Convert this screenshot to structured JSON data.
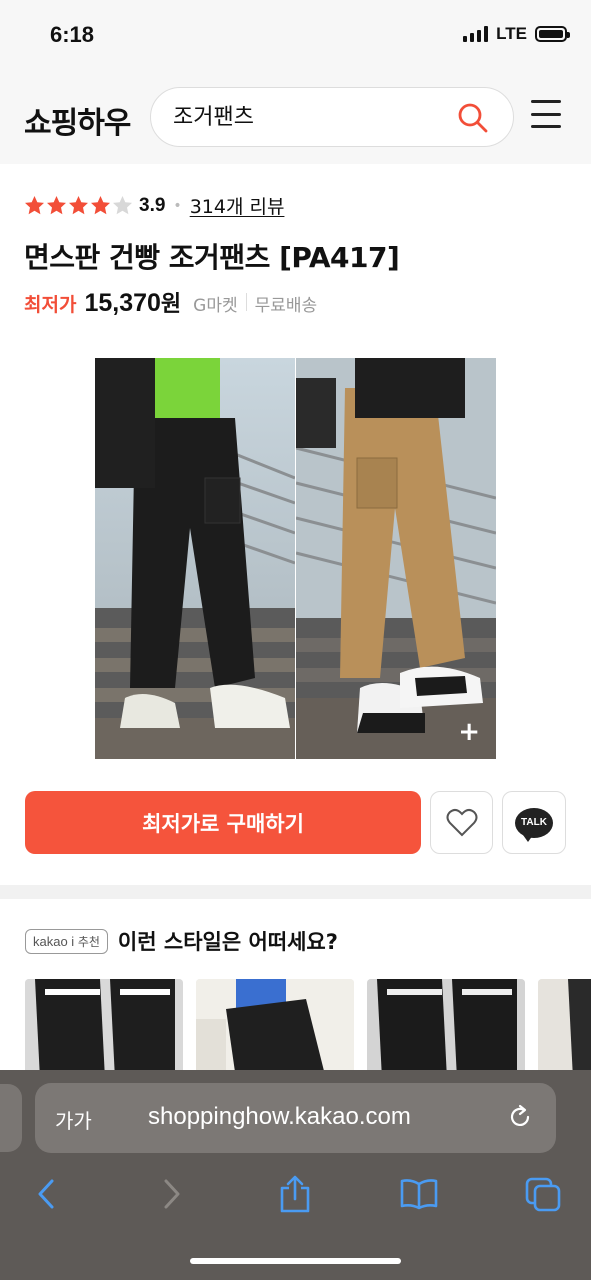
{
  "status_bar": {
    "time": "6:18",
    "network": "LTE"
  },
  "header": {
    "logo": "쇼핑하우",
    "search_value": "조거팬츠",
    "search_icon": "search-icon",
    "menu_icon": "hamburger-menu-icon"
  },
  "product": {
    "rating_stars": 3.9,
    "rating": "3.9",
    "reviews": "314개 리뷰",
    "title": "면스판 건빵 조거팬츠 [PA417]",
    "lowest_label": "최저가",
    "price": "15,370",
    "price_unit": "원",
    "seller": "G마켓",
    "shipping": "무료배송",
    "image_plus": "+"
  },
  "actions": {
    "buy_label": "최저가로 구매하기",
    "talk_label": "TALK"
  },
  "recommend": {
    "badge_en": "kakao i",
    "badge_ko": "추천",
    "title": "이런 스타일은 어떠세요?"
  },
  "safari": {
    "aa": "가가",
    "url": "shoppinghow.kakao.com"
  },
  "colors": {
    "accent": "#f5543c",
    "star": "#f24e38"
  }
}
